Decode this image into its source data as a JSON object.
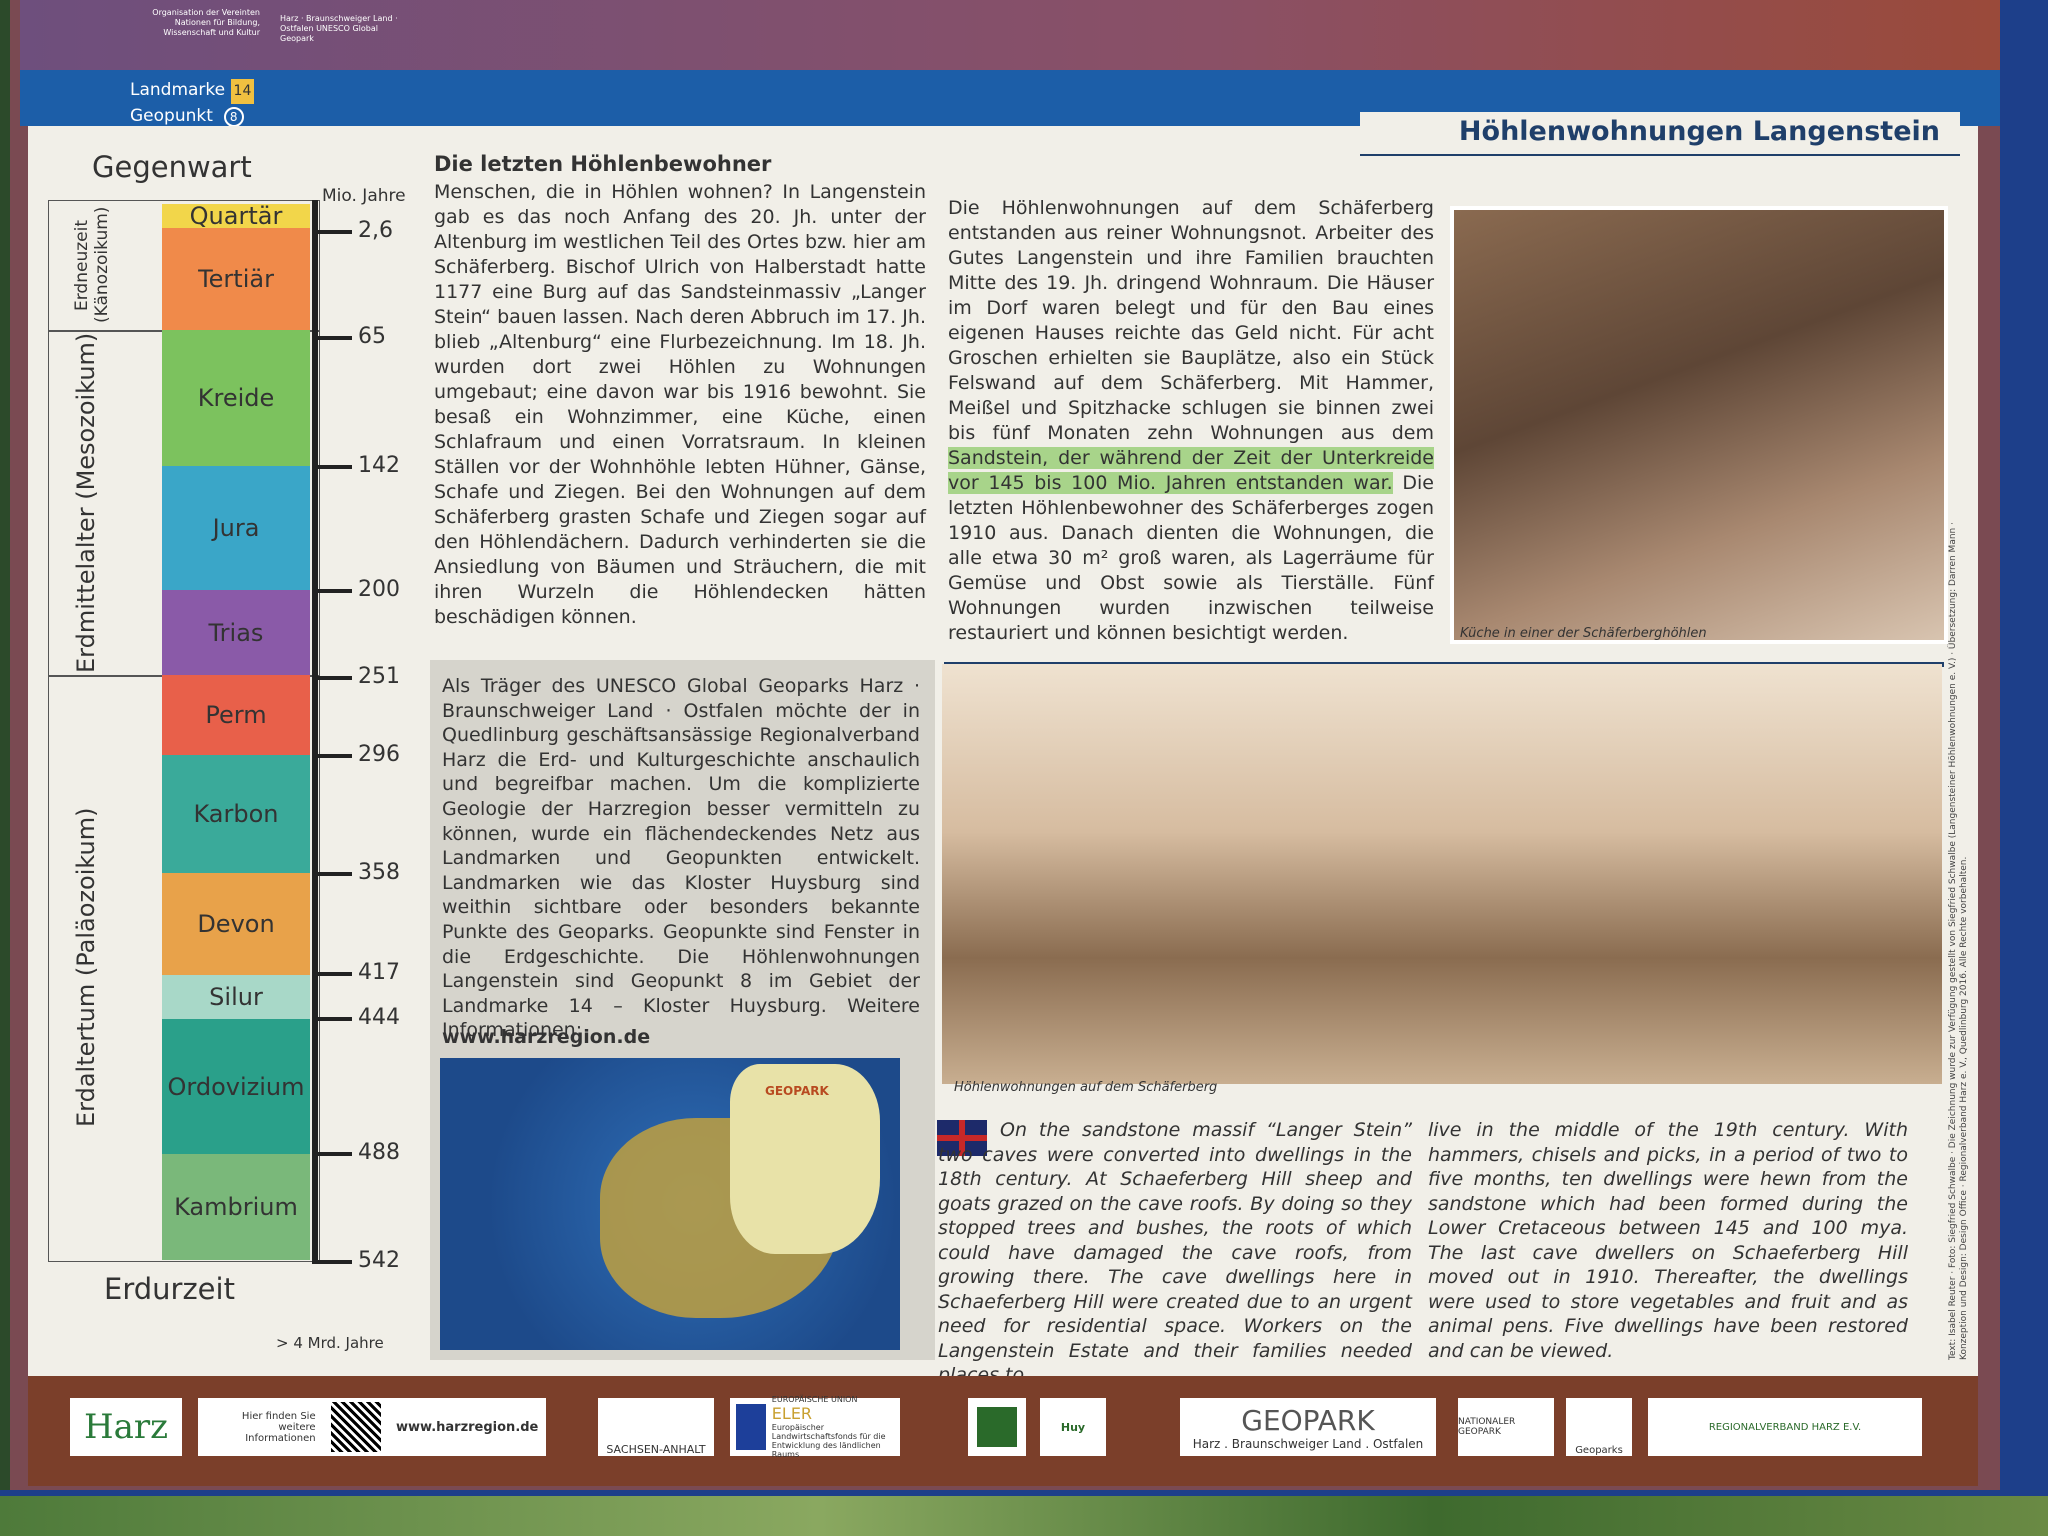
{
  "header": {
    "org_left": "Organisation der Vereinten Nationen für Bildung, Wissenschaft und Kultur",
    "org_right": "Harz · Braunschweiger Land · Ostfalen UNESCO Global Geopark",
    "landmarke_label": "Landmarke",
    "landmarke_num": "14",
    "geopunkt_label": "Geopunkt",
    "geopunkt_num": "8",
    "title": "Höhlenwohnungen Langenstein"
  },
  "timeline": {
    "top_label": "Gegenwart",
    "unit_label": "Mio. Jahre",
    "bottom_label": "Erdurzeit",
    "bottom_unit": "> 4 Mrd. Jahre",
    "eras": [
      {
        "name": "Erdneuzeit",
        "sub": "(Känozoikum)"
      },
      {
        "name": "Erdmittelalter",
        "sub": "(Mesozoikum)"
      },
      {
        "name": "Erdaltertum",
        "sub": "(Paläozoikum)"
      }
    ],
    "periods": [
      "Quartär",
      "Tertiär",
      "Kreide",
      "Jura",
      "Trias",
      "Perm",
      "Karbon",
      "Devon",
      "Silur",
      "Ordovizium",
      "Kambrium"
    ],
    "ticks": [
      "2,6",
      "65",
      "142",
      "200",
      "251",
      "296",
      "358",
      "417",
      "444",
      "488",
      "542"
    ],
    "colors": [
      "#f2d64a",
      "#f08a4a",
      "#7cc25e",
      "#3aa6c8",
      "#8a5aa8",
      "#e8604a",
      "#3aaa9a",
      "#e8a24a",
      "#a8d8c8",
      "#2aa08a",
      "#7ab87a"
    ]
  },
  "col1": {
    "heading": "Die letzten Höhlenbewohner",
    "text": "Menschen, die in Höhlen wohnen? In Langenstein gab es das noch Anfang des 20. Jh. unter der Altenburg im westlichen Teil des Ortes bzw. hier am Schäferberg. Bischof Ulrich von Halberstadt hatte 1177 eine Burg auf das Sandsteinmassiv „Langer Stein“ bauen lassen. Nach deren Abbruch im 17. Jh. blieb „Altenburg“ eine Flurbezeichnung. Im 18. Jh. wurden dort zwei Höhlen zu Wohnungen umgebaut; eine davon war bis 1916 bewohnt. Sie besaß ein Wohnzimmer, eine Küche, einen Schlafraum und einen Vorratsraum. In kleinen Ställen vor der Wohnhöhle lebten Hühner, Gänse, Schafe und Ziegen. Bei den Wohnungen auf dem Schäferberg grasten Schafe und Ziegen sogar auf den Höhlendächern. Dadurch verhinderten sie die Ansiedlung von Bäumen und Sträuchern, die mit ihren Wurzeln die Höhlendecken hätten beschädigen können."
  },
  "col2": {
    "text_a": "Die Höhlenwohnungen auf dem Schäferberg entstanden aus reiner Wohnungsnot. Arbeiter des Gutes Langenstein und ihre Familien brauchten Mitte des 19. Jh. dringend Wohnraum. Die Häuser im Dorf waren belegt und für den Bau eines eigenen Hauses reichte das Geld nicht. Für acht Groschen erhielten sie Bauplätze, also ein Stück Felswand auf dem Schäferberg. Mit Hammer, Meißel und Spitzhacke schlugen sie binnen zwei bis fünf Monaten zehn Wohnungen aus dem",
    "highlight": "Sandstein, der während der Zeit der Unterkreide vor 145 bis 100 Mio. Jahren entstanden war.",
    "text_b": "Die letzten Höhlenbewohner des Schäferberges zogen 1910 aus. Danach dienten die Wohnungen, die alle etwa 30 m² groß waren, als Lagerräume für Gemüse und Obst sowie als Tierställe. Fünf Wohnungen wurden inzwischen teilweise restauriert und können besichtigt werden."
  },
  "photo1_caption": "Küche in einer der Schäferberghöhlen",
  "photo2_caption": "Höhlenwohnungen auf dem Schäferberg",
  "graybox": {
    "text": "Als Träger des UNESCO Global Geoparks Harz · Braunschweiger Land · Ostfalen möchte der in Quedlinburg geschäftsansässige Regionalverband Harz die Erd- und Kulturgeschichte anschaulich und begreifbar machen. Um die komplizierte Geologie der Harzregion besser vermitteln zu können, wurde ein flächendeckendes Netz aus Landmarken und Geopunkten entwickelt. Landmarken wie das Kloster Huysburg sind weithin sichtbare oder besonders bekannte Punkte des Geoparks. Geopunkte sind Fenster in die Erdgeschichte. Die Höhlenwohnungen Langenstein sind Geopunkt 8 im Gebiet der Landmarke 14 – Kloster Huysburg. Weitere Informationen:",
    "url": "www.harzregion.de",
    "map_label": "GEOPARK"
  },
  "english": {
    "left": "On the sandstone massif “Langer Stein” two caves were converted into dwellings in the 18th century. At Schaeferberg Hill sheep and goats grazed on the cave roofs. By doing so they stopped trees and bushes, the roots of which could have damaged the cave roofs, from growing there. The cave dwellings here in Schaeferberg Hill were created due to an urgent need for residential space. Workers on the Langenstein Estate and their families needed places to",
    "right": "live in the middle of the 19th century. With hammers, chisels and picks, in a period of two to five months, ten dwellings were hewn from the sandstone which had been formed during the Lower Cretaceous between 145 and 100 mya. The last cave dwellers on Schaeferberg Hill moved out in 1910. Thereafter, the dwellings were used to store vegetables and fruit and as animal pens. Five dwellings have been restored and can be viewed."
  },
  "credits": "Text: Isabel Reuter · Foto: Siegfried Schwalbe · Die Zeichnung wurde zur Verfügung gestellt von Siegfried Schwalbe (Langensteiner Höhlenwohnungen e. V.) · Übersetzung: Darren Mann · Konzeption und Design: Design Office · Regionalverband Harz e. V., Quedlinburg 2016. Alle Rechte vorbehalten.",
  "footer": {
    "harz": "Harz",
    "qr_text": "Hier finden Sie weitere Informationen",
    "qr_url": "www.harzregion.de",
    "sachsen": "SACHSEN-ANHALT",
    "eu_top": "EUROPÄISCHE UNION",
    "eler": "ELER",
    "eu_text": "Europäischer Landwirtschaftsfonds für die Entwicklung des ländlichen Raums",
    "huy": "Huy",
    "geopark": "GEOPARK",
    "geopark_sub": "Harz . Braunschweiger Land . Ostfalen",
    "national": "NATIONALER GEOPARK",
    "geoparks": "Geoparks",
    "regionalverband": "REGIONALVERBAND HARZ E.V."
  }
}
